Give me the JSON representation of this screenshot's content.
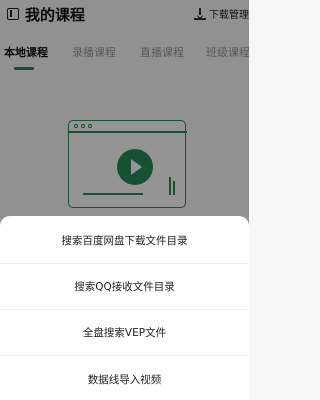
{
  "header": {
    "title": "我的课程",
    "download_label": "下载管理"
  },
  "tabs": [
    {
      "label": "本地课程",
      "active": true
    },
    {
      "label": "录播课程",
      "active": false
    },
    {
      "label": "直播课程",
      "active": false
    },
    {
      "label": "班级课程",
      "active": false
    }
  ],
  "colors": {
    "accent": "#2a8a5b",
    "overlay": "rgba(0,0,0,0.42)"
  },
  "bottom_sheet": {
    "items": [
      {
        "label": "搜索百度网盘下载文件目录"
      },
      {
        "label": "搜索QQ接收文件目录"
      },
      {
        "label": "全盘搜索VEP文件"
      },
      {
        "label": "数据线导入视频"
      }
    ]
  }
}
